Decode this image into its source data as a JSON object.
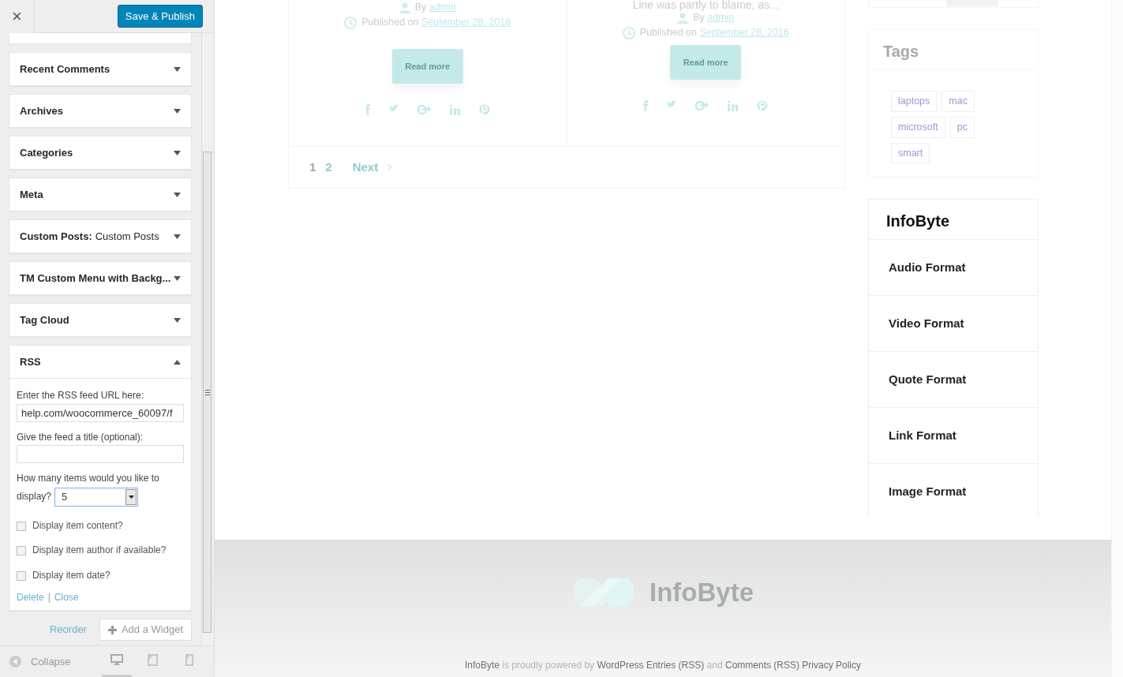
{
  "customizer": {
    "close": "×",
    "save_button": "Save & Publish",
    "widgets": [
      {
        "title": "Recent Comments",
        "expanded": false
      },
      {
        "title": "Archives",
        "expanded": false
      },
      {
        "title": "Categories",
        "expanded": false
      },
      {
        "title": "Meta",
        "expanded": false
      },
      {
        "title": "Custom Posts:",
        "instance": "Custom Posts",
        "expanded": false
      },
      {
        "title": "TM Custom Menu with Backg...",
        "expanded": false
      },
      {
        "title": "Tag Cloud",
        "expanded": false
      },
      {
        "title": "RSS",
        "expanded": true
      }
    ],
    "rss_form": {
      "url_label": "Enter the RSS feed URL here:",
      "url_value": "help.com/woocommerce_60097/f",
      "title_label": "Give the feed a title (optional):",
      "items_label": "How many items would you like to",
      "items_label_end": "display?",
      "items_value": "5",
      "checkboxes": [
        {
          "label": "Display item content?",
          "checked": false
        },
        {
          "label": "Display item author if available?",
          "checked": false
        },
        {
          "label": "Display item date?",
          "checked": false
        }
      ],
      "delete": "Delete",
      "separator": "|",
      "close": "Close"
    },
    "reorder": "Reorder",
    "add_widget": "Add a Widget",
    "collapse": "Collapse",
    "devices": [
      {
        "kind": "desktop",
        "selected": true
      },
      {
        "kind": "tablet",
        "selected": false
      },
      {
        "kind": "mobile",
        "selected": false
      }
    ]
  },
  "preview": {
    "posts": [
      {
        "by": "By",
        "author": "admin",
        "published": "Published on",
        "date": "September 28, 2016",
        "read_more": "Read more"
      },
      {
        "excerpt": "Line was partly to blame, as...",
        "by": "By",
        "author": "admin",
        "published": "Published on",
        "date": "September 28, 2016",
        "read_more": "Read more"
      }
    ],
    "pagination": [
      {
        "label": "1",
        "selected": true
      },
      {
        "label": "2",
        "selected": false
      }
    ],
    "next": "Next",
    "tags_widget": {
      "title": "Tags",
      "tags": [
        "laptops",
        "mac",
        "microsoft",
        "pc",
        "smart"
      ]
    },
    "links_widget": {
      "title": "InfoByte",
      "links": [
        "Audio Format",
        "Video Format",
        "Quote Format",
        "Link Format",
        "Image Format"
      ]
    },
    "footer": {
      "logo_text": "InfoByte",
      "credits": [
        {
          "text": "InfoByte",
          "link": true
        },
        {
          "text": "is proudly powered by",
          "link": false
        },
        {
          "text": "WordPress",
          "link": true
        },
        {
          "text": "Entries (RSS)",
          "link": true
        },
        {
          "text": "and",
          "link": false
        },
        {
          "text": "Comments (RSS)",
          "link": true
        },
        {
          "text": "Privacy Policy",
          "link": true
        }
      ]
    }
  }
}
